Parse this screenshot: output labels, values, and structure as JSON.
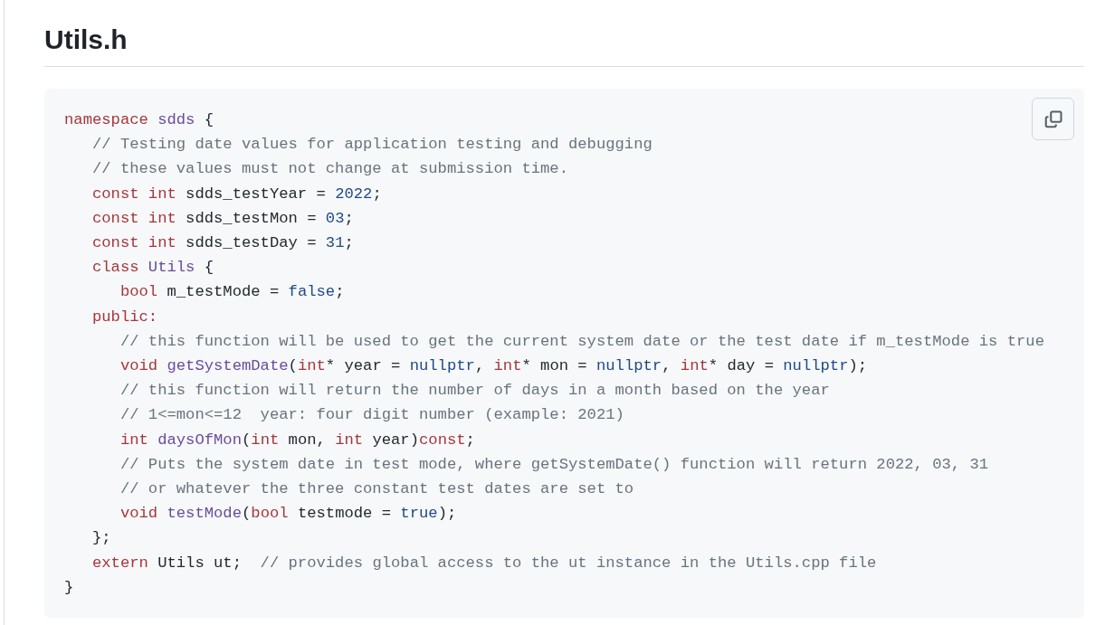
{
  "heading": "Utils.h",
  "code": {
    "lines": [
      [
        {
          "kind": "keyword",
          "text": "namespace "
        },
        {
          "kind": "entity",
          "text": "sdds"
        },
        {
          "kind": "plain",
          "text": " {"
        }
      ],
      [
        {
          "kind": "comment",
          "text": "   // Testing date values for application testing and debugging"
        }
      ],
      [
        {
          "kind": "comment",
          "text": "   // these values must not change at submission time."
        }
      ],
      [
        {
          "kind": "keyword",
          "text": "   const int"
        },
        {
          "kind": "plain",
          "text": " sdds_testYear = "
        },
        {
          "kind": "constant",
          "text": "2022"
        },
        {
          "kind": "plain",
          "text": ";"
        }
      ],
      [
        {
          "kind": "keyword",
          "text": "   const int"
        },
        {
          "kind": "plain",
          "text": " sdds_testMon = "
        },
        {
          "kind": "constant",
          "text": "03"
        },
        {
          "kind": "plain",
          "text": ";"
        }
      ],
      [
        {
          "kind": "keyword",
          "text": "   const int"
        },
        {
          "kind": "plain",
          "text": " sdds_testDay = "
        },
        {
          "kind": "constant",
          "text": "31"
        },
        {
          "kind": "plain",
          "text": ";"
        }
      ],
      [
        {
          "kind": "keyword",
          "text": "   class "
        },
        {
          "kind": "entity",
          "text": "Utils"
        },
        {
          "kind": "plain",
          "text": " {"
        }
      ],
      [
        {
          "kind": "keyword",
          "text": "      bool"
        },
        {
          "kind": "plain",
          "text": " m_testMode = "
        },
        {
          "kind": "constant",
          "text": "false"
        },
        {
          "kind": "plain",
          "text": ";"
        }
      ],
      [
        {
          "kind": "keyword",
          "text": "   public:"
        }
      ],
      [
        {
          "kind": "comment",
          "text": "      // this function will be used to get the current system date or the test date if m_testMode is true"
        }
      ],
      [
        {
          "kind": "keyword",
          "text": "      void "
        },
        {
          "kind": "entity",
          "text": "getSystemDate"
        },
        {
          "kind": "plain",
          "text": "("
        },
        {
          "kind": "keyword",
          "text": "int"
        },
        {
          "kind": "plain",
          "text": "* year = "
        },
        {
          "kind": "constant",
          "text": "nullptr"
        },
        {
          "kind": "plain",
          "text": ", "
        },
        {
          "kind": "keyword",
          "text": "int"
        },
        {
          "kind": "plain",
          "text": "* mon = "
        },
        {
          "kind": "constant",
          "text": "nullptr"
        },
        {
          "kind": "plain",
          "text": ", "
        },
        {
          "kind": "keyword",
          "text": "int"
        },
        {
          "kind": "plain",
          "text": "* day = "
        },
        {
          "kind": "constant",
          "text": "nullptr"
        },
        {
          "kind": "plain",
          "text": ");"
        }
      ],
      [
        {
          "kind": "comment",
          "text": "      // this function will return the number of days in a month based on the year"
        }
      ],
      [
        {
          "kind": "comment",
          "text": "      // 1<=mon<=12  year: four digit number (example: 2021)"
        }
      ],
      [
        {
          "kind": "keyword",
          "text": "      int "
        },
        {
          "kind": "entity",
          "text": "daysOfMon"
        },
        {
          "kind": "plain",
          "text": "("
        },
        {
          "kind": "keyword",
          "text": "int"
        },
        {
          "kind": "plain",
          "text": " mon, "
        },
        {
          "kind": "keyword",
          "text": "int"
        },
        {
          "kind": "plain",
          "text": " year)"
        },
        {
          "kind": "keyword",
          "text": "const"
        },
        {
          "kind": "plain",
          "text": ";"
        }
      ],
      [
        {
          "kind": "comment",
          "text": "      // Puts the system date in test mode, where getSystemDate() function will return 2022, 03, 31"
        }
      ],
      [
        {
          "kind": "comment",
          "text": "      // or whatever the three constant test dates are set to"
        }
      ],
      [
        {
          "kind": "keyword",
          "text": "      void "
        },
        {
          "kind": "entity",
          "text": "testMode"
        },
        {
          "kind": "plain",
          "text": "("
        },
        {
          "kind": "keyword",
          "text": "bool"
        },
        {
          "kind": "plain",
          "text": " testmode = "
        },
        {
          "kind": "constant",
          "text": "true"
        },
        {
          "kind": "plain",
          "text": ");"
        }
      ],
      [
        {
          "kind": "plain",
          "text": "   };"
        }
      ],
      [
        {
          "kind": "keyword",
          "text": "   extern"
        },
        {
          "kind": "plain",
          "text": " Utils ut;  "
        },
        {
          "kind": "comment",
          "text": "// provides global access to the ut instance in the Utils.cpp file"
        }
      ],
      [
        {
          "kind": "plain",
          "text": "}"
        }
      ]
    ]
  }
}
